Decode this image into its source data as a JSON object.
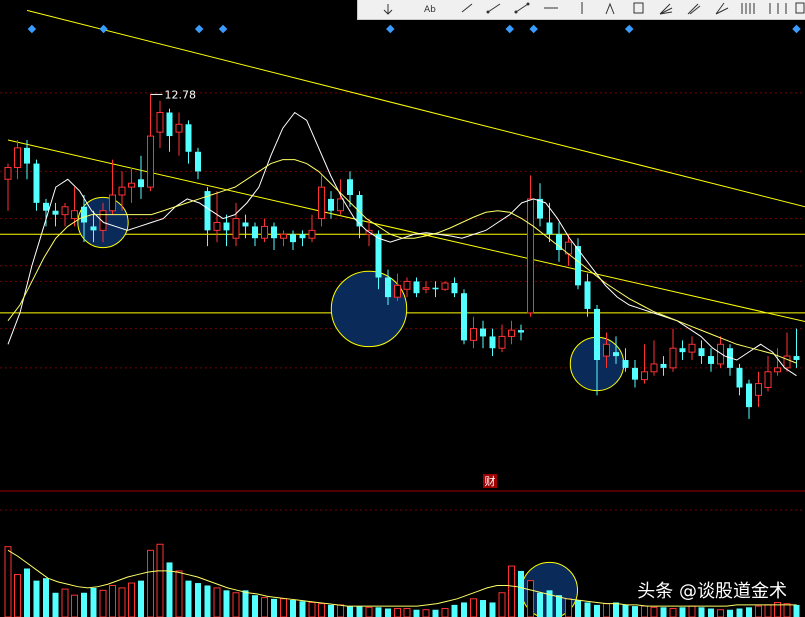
{
  "colors": {
    "up": "#ff3232",
    "down": "#54ffff",
    "trendline": "#ffff00",
    "ma_short": "#ffffff",
    "ma_long": "#ffff66",
    "gridline": "#7a0000",
    "circle_fill": "#0a2a5a",
    "circle_stroke": "#ffff00",
    "toolbar_bg": "#f0f0f0",
    "marker": "#3b9cff"
  },
  "toolbar": {
    "icons": [
      "arrow-icon",
      "text-icon",
      "line-icon",
      "ray-icon",
      "segment-icon",
      "horizontal-segment-icon",
      "vertical-line-icon",
      "arrow-up-icon",
      "rectangle-icon",
      "fibonacci-fan-icon",
      "speed-line-icon",
      "gann-fan-icon",
      "parallel-lines-icon",
      "cycle-lines-icon",
      "square-icon"
    ]
  },
  "finance_marker": "财",
  "watermark": "头条 @谈股道金术",
  "chart_data": [
    {
      "type": "candlestick",
      "title": "",
      "high_annotation": "12.78",
      "y_range": [
        8.0,
        13.6
      ],
      "horizontal_levels": [
        11.0,
        10.0
      ],
      "gridlines": [
        12.8,
        11.8,
        11.2,
        10.6,
        10.4,
        9.8,
        9.3
      ],
      "channel": {
        "upper": [
          [
            2,
            13.85
          ],
          [
            138,
            9.7
          ]
        ],
        "lower": [
          [
            0,
            12.2
          ],
          [
            138,
            8.4
          ]
        ]
      },
      "ma_short": [
        9.6,
        10.0,
        10.6,
        11.1,
        11.6,
        11.7,
        11.55,
        11.3,
        11.15,
        11.1,
        11.05,
        11.1,
        11.15,
        11.2,
        11.35,
        11.45,
        11.4,
        11.3,
        11.2,
        11.25,
        11.4,
        11.6,
        12.0,
        12.35,
        12.55,
        12.45,
        12.1,
        11.75,
        11.45,
        11.2,
        11.05,
        10.95,
        10.9,
        10.95,
        11.0,
        11.02,
        11.0,
        10.98,
        10.95,
        11.0,
        11.05,
        11.15,
        11.25,
        11.4,
        11.45,
        11.4,
        11.2,
        10.95,
        10.75,
        10.55,
        10.35,
        10.2,
        10.1,
        10.05,
        10.0,
        9.95,
        9.9,
        9.8,
        9.7,
        9.55,
        9.45,
        9.4,
        9.5,
        9.6,
        9.5,
        9.3,
        9.2
      ],
      "ma_long": [
        9.9,
        10.1,
        10.4,
        10.7,
        10.95,
        11.1,
        11.2,
        11.25,
        11.25,
        11.25,
        11.25,
        11.25,
        11.25,
        11.3,
        11.35,
        11.4,
        11.45,
        11.5,
        11.55,
        11.6,
        11.7,
        11.8,
        11.9,
        11.95,
        11.95,
        11.9,
        11.8,
        11.65,
        11.5,
        11.35,
        11.2,
        11.1,
        11.0,
        10.95,
        10.95,
        10.98,
        11.02,
        11.08,
        11.15,
        11.22,
        11.28,
        11.3,
        11.28,
        11.2,
        11.1,
        10.98,
        10.86,
        10.74,
        10.62,
        10.5,
        10.38,
        10.28,
        10.18,
        10.1,
        10.02,
        9.96,
        9.9,
        9.84,
        9.78,
        9.72,
        9.66,
        9.6,
        9.56,
        9.52,
        9.48,
        9.42,
        9.36
      ],
      "candles": [
        [
          11.7,
          11.85,
          11.9,
          11.3
        ],
        [
          11.85,
          12.1,
          12.2,
          11.7
        ],
        [
          12.1,
          11.9,
          12.2,
          11.7
        ],
        [
          11.9,
          11.4,
          11.95,
          11.3
        ],
        [
          11.4,
          11.3,
          11.45,
          11.1
        ],
        [
          11.3,
          11.25,
          11.4,
          11.1
        ],
        [
          11.25,
          11.35,
          11.4,
          11.1
        ],
        [
          11.2,
          11.3,
          11.6,
          11.1
        ],
        [
          11.35,
          11.15,
          11.5,
          10.9
        ],
        [
          11.1,
          11.05,
          11.3,
          10.9
        ],
        [
          11.05,
          11.3,
          11.4,
          10.9
        ],
        [
          11.3,
          11.5,
          11.95,
          11.25
        ],
        [
          11.5,
          11.6,
          11.8,
          11.3
        ],
        [
          11.6,
          11.65,
          11.85,
          11.4
        ],
        [
          11.7,
          11.6,
          12.0,
          11.45
        ],
        [
          11.6,
          12.25,
          12.78,
          11.55
        ],
        [
          12.3,
          12.55,
          12.7,
          12.1
        ],
        [
          12.55,
          12.25,
          12.6,
          12.05
        ],
        [
          12.3,
          12.4,
          12.55,
          12.0
        ],
        [
          12.4,
          12.05,
          12.45,
          11.9
        ],
        [
          12.05,
          11.8,
          12.1,
          11.7
        ],
        [
          11.55,
          11.05,
          11.6,
          10.85
        ],
        [
          11.05,
          11.15,
          11.55,
          10.9
        ],
        [
          11.15,
          11.05,
          11.25,
          10.85
        ],
        [
          10.95,
          11.2,
          11.4,
          10.85
        ],
        [
          11.15,
          11.1,
          11.25,
          10.95
        ],
        [
          11.1,
          10.95,
          11.15,
          10.85
        ],
        [
          10.95,
          11.1,
          11.2,
          10.9
        ],
        [
          11.1,
          10.95,
          11.15,
          10.8
        ],
        [
          10.95,
          11.0,
          11.05,
          10.85
        ],
        [
          11.0,
          10.9,
          11.05,
          10.8
        ],
        [
          11.0,
          10.95,
          11.05,
          10.85
        ],
        [
          10.95,
          11.05,
          11.25,
          10.9
        ],
        [
          11.2,
          11.6,
          11.75,
          11.1
        ],
        [
          11.45,
          11.3,
          11.55,
          11.2
        ],
        [
          11.3,
          11.45,
          11.7,
          11.25
        ],
        [
          11.7,
          11.5,
          11.8,
          11.35
        ],
        [
          11.5,
          11.1,
          11.55,
          10.95
        ],
        [
          11.0,
          11.05,
          11.2,
          10.85
        ],
        [
          11.0,
          10.45,
          11.05,
          10.3
        ],
        [
          10.45,
          10.2,
          10.55,
          10.1
        ],
        [
          10.2,
          10.35,
          10.5,
          10.15
        ],
        [
          10.3,
          10.4,
          10.45,
          10.2
        ],
        [
          10.4,
          10.25,
          10.45,
          10.2
        ],
        [
          10.3,
          10.32,
          10.4,
          10.25
        ],
        [
          10.32,
          10.3,
          10.4,
          10.2
        ],
        [
          10.3,
          10.38,
          10.4,
          10.28
        ],
        [
          10.38,
          10.25,
          10.45,
          10.2
        ],
        [
          10.25,
          9.65,
          10.3,
          9.6
        ],
        [
          9.65,
          9.8,
          9.95,
          9.55
        ],
        [
          9.8,
          9.7,
          9.9,
          9.55
        ],
        [
          9.7,
          9.55,
          9.8,
          9.45
        ],
        [
          9.55,
          9.7,
          9.85,
          9.5
        ],
        [
          9.7,
          9.78,
          9.9,
          9.6
        ],
        [
          9.78,
          9.75,
          9.85,
          9.65
        ],
        [
          10.0,
          11.45,
          11.75,
          9.95
        ],
        [
          11.45,
          11.2,
          11.65,
          11.1
        ],
        [
          11.15,
          11.0,
          11.4,
          10.9
        ],
        [
          11.0,
          10.8,
          11.15,
          10.65
        ],
        [
          10.75,
          10.9,
          11.0,
          10.6
        ],
        [
          10.85,
          10.35,
          10.95,
          10.3
        ],
        [
          10.4,
          10.05,
          10.5,
          9.95
        ],
        [
          10.05,
          9.4,
          10.1,
          8.95
        ],
        [
          9.45,
          9.6,
          9.75,
          9.3
        ],
        [
          9.5,
          9.45,
          9.7,
          9.35
        ],
        [
          9.4,
          9.3,
          9.55,
          9.25
        ],
        [
          9.3,
          9.15,
          9.4,
          9.05
        ],
        [
          9.15,
          9.25,
          9.6,
          9.1
        ],
        [
          9.25,
          9.35,
          9.65,
          9.2
        ],
        [
          9.35,
          9.3,
          9.45,
          9.2
        ],
        [
          9.3,
          9.55,
          9.8,
          9.25
        ],
        [
          9.55,
          9.5,
          9.65,
          9.4
        ],
        [
          9.5,
          9.6,
          9.7,
          9.4
        ],
        [
          9.55,
          9.45,
          9.65,
          9.35
        ],
        [
          9.45,
          9.35,
          9.55,
          9.25
        ],
        [
          9.35,
          9.6,
          9.7,
          9.3
        ],
        [
          9.55,
          9.3,
          9.6,
          9.2
        ],
        [
          9.3,
          9.05,
          9.35,
          8.95
        ],
        [
          9.1,
          8.8,
          9.15,
          8.65
        ],
        [
          8.95,
          9.1,
          9.25,
          8.8
        ],
        [
          9.05,
          9.25,
          9.45,
          9.0
        ],
        [
          9.25,
          9.3,
          9.55,
          9.2
        ],
        [
          9.3,
          9.45,
          9.75,
          9.25
        ],
        [
          9.45,
          9.4,
          9.8,
          9.3
        ]
      ],
      "circles": [
        {
          "candle": 10,
          "price": 11.15,
          "radius": 0.32
        },
        {
          "candle": 38,
          "price": 10.05,
          "radius": 0.48
        },
        {
          "candle": 62,
          "price": 9.35,
          "radius": 0.34
        }
      ],
      "markers": [
        1,
        4,
        8,
        9,
        16,
        21,
        22,
        26,
        33
      ]
    },
    {
      "type": "bar",
      "title": "",
      "volumes": [
        58,
        35,
        40,
        30,
        32,
        20,
        23,
        18,
        20,
        24,
        22,
        26,
        24,
        28,
        30,
        55,
        60,
        45,
        38,
        30,
        28,
        26,
        24,
        22,
        20,
        22,
        18,
        16,
        15,
        15,
        14,
        13,
        12,
        11,
        10,
        10,
        9,
        9,
        8,
        8,
        7,
        7,
        7,
        6,
        6,
        6,
        7,
        10,
        12,
        15,
        14,
        12,
        20,
        42,
        38,
        30,
        20,
        22,
        18,
        15,
        14,
        12,
        10,
        11,
        12,
        10,
        9,
        9,
        8,
        8,
        7,
        8,
        9,
        8,
        7,
        6,
        6,
        7,
        8,
        9,
        10,
        12,
        11,
        10
      ],
      "ma_volume": [
        55,
        50,
        44,
        38,
        32,
        29,
        27,
        25,
        24,
        25,
        27,
        30,
        33,
        35,
        37,
        38,
        38,
        37,
        35,
        33,
        30,
        27,
        24,
        22,
        20,
        19,
        17,
        16,
        15,
        14,
        13,
        12,
        11,
        10,
        9,
        9,
        9,
        9,
        9,
        9,
        9,
        9,
        10,
        11,
        13,
        15,
        18,
        21,
        24,
        26,
        26,
        25,
        23,
        21,
        19,
        17,
        15,
        14,
        13,
        12,
        11,
        11,
        10,
        10,
        9,
        9,
        9,
        9,
        9,
        9,
        9,
        9,
        9,
        10,
        10,
        10,
        10,
        10,
        10,
        10
      ],
      "y_range": [
        0,
        80
      ],
      "circle": {
        "bar": 57,
        "value": 22,
        "radius": 12
      }
    }
  ]
}
